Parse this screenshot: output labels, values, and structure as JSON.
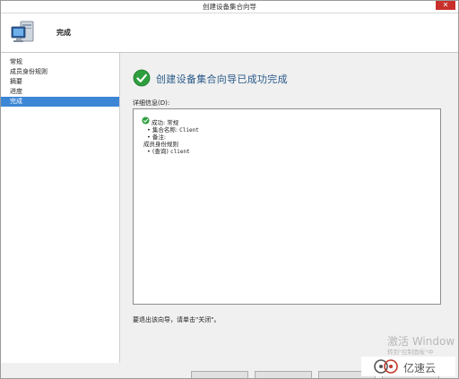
{
  "window": {
    "title": "创建设备集合向导",
    "close_label": "✕"
  },
  "header": {
    "page_title": "完成",
    "icon": "computer-icon"
  },
  "sidebar": {
    "items": [
      {
        "label": "常规"
      },
      {
        "label": "成员身份规则"
      },
      {
        "label": "摘要"
      },
      {
        "label": "进度"
      },
      {
        "label": "完成",
        "active": true
      }
    ]
  },
  "main": {
    "heading": "创建设备集合向导已成功完成",
    "details_label": "详细信息(D):",
    "details": {
      "line1_prefix": "成功: ",
      "line1_value": "常规",
      "line2_prefix": "• 集合名称: ",
      "line2_value": "Client",
      "line3": "• 备注:",
      "line4": "成员身份规则",
      "line5_prefix": "• (查询) ",
      "line5_value": "client"
    },
    "footer_note": "要退出该向导，请单击\"关闭\"。"
  },
  "watermark": {
    "main": "激活 Window",
    "sub": "转到\"控制面板\"中"
  },
  "brand": {
    "text": "亿速云"
  },
  "colors": {
    "accent": "#3d86d6",
    "success": "#2e9e3e",
    "heading": "#2a5a8a"
  }
}
